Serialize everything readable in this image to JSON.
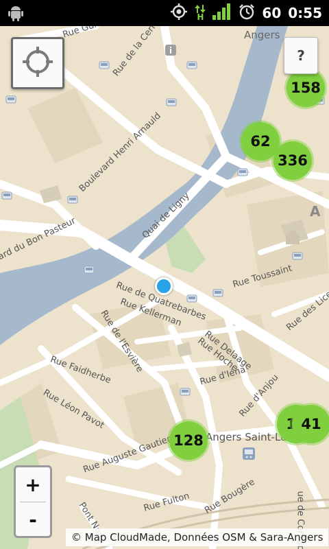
{
  "status_bar": {
    "battery": "60",
    "time": "0:55",
    "network_type": "H",
    "icons": [
      "android-icon",
      "gps-icon",
      "data-arrows-icon",
      "signal-icon",
      "alarm-icon"
    ]
  },
  "map": {
    "street_labels": [
      "Rue Guittet",
      "Rue de la Cerf",
      "Angers",
      "Boulevard Henri Arnauld",
      "Quai de Ligny",
      "ard du Bon Pasteur",
      "Rue Toussaint",
      "Rue de Quatrebarbes",
      "Rue Kellerman",
      "Rue de l'Esvière",
      "Rue Delaage",
      "Rue Hoche",
      "Rue d'Iéna",
      "Rue des Lices",
      "Rue Faidherbe",
      "Rue Léon Pavot",
      "Rue d'Anjou",
      "Angers Saint-Laud",
      "Rue Auguste Gautier",
      "Pont Noir",
      "Rue Fulton",
      "Rue Bougère",
      "ue de Contades",
      "A"
    ],
    "clusters": [
      "158",
      "62",
      "336",
      "18",
      "41",
      "128"
    ],
    "attribution": "© Map CloudMade, Données OSM & Sara-Angers"
  },
  "controls": {
    "help_label": "?",
    "zoom_in_label": "+",
    "zoom_out_label": "-"
  },
  "colors": {
    "land": "#ede3cd",
    "water": "#a6b9cc",
    "park": "#c9ddb5",
    "cluster": "#7fcf3e",
    "user_location": "#29a3e8"
  }
}
